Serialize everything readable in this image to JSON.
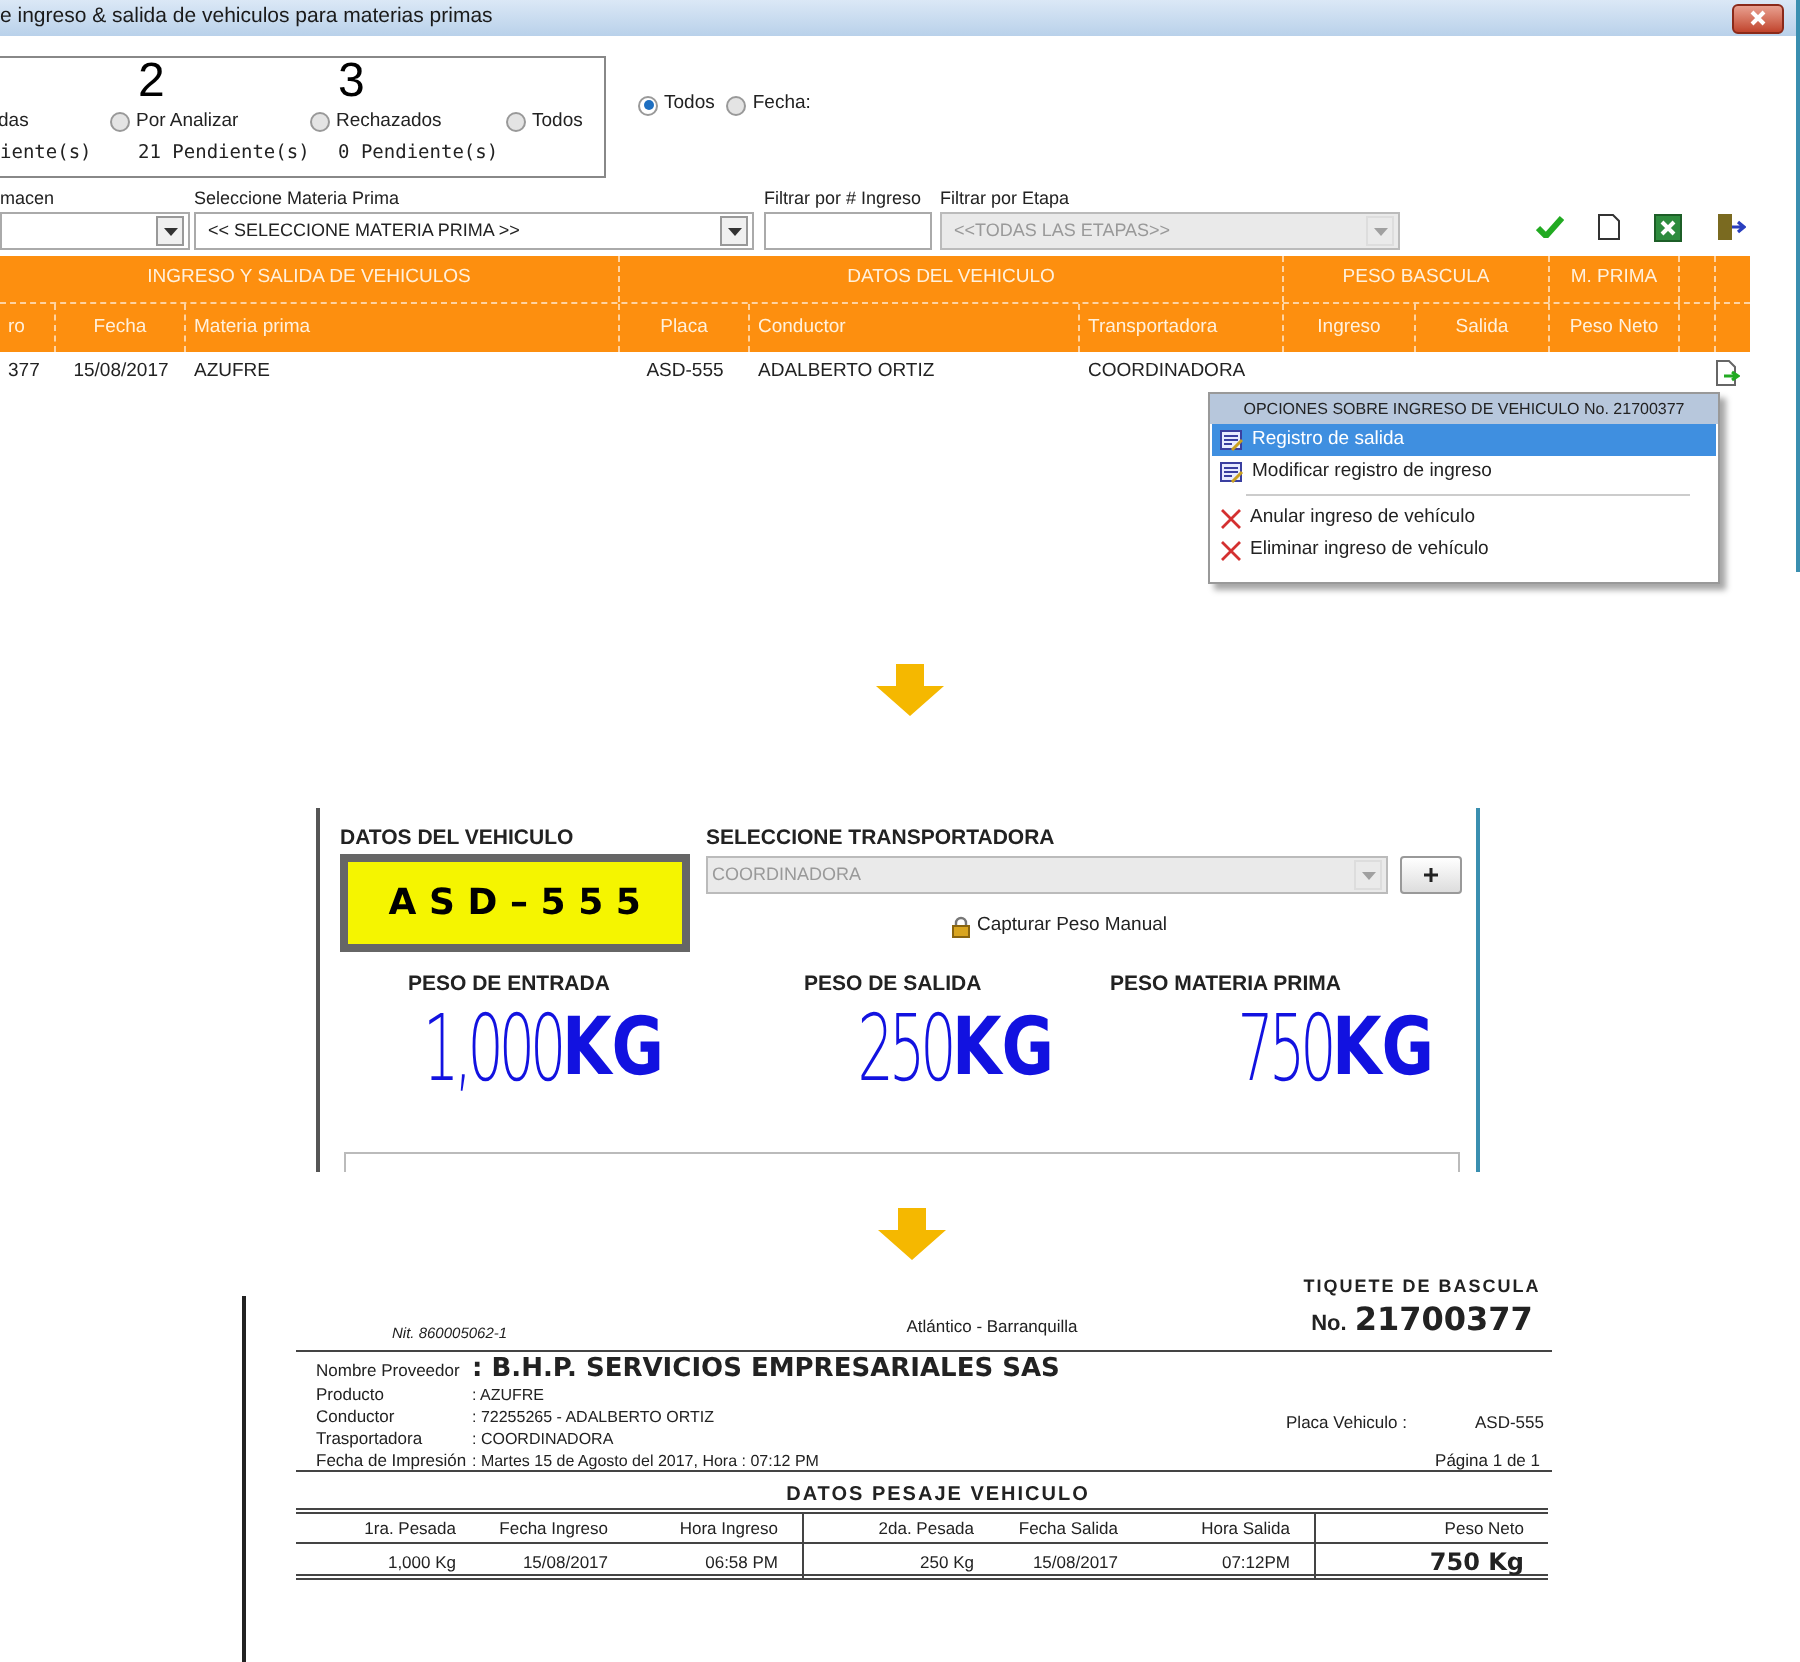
{
  "window": {
    "title": "e ingreso & salida de vehiculos para materias primas"
  },
  "status_filters": [
    {
      "kind": "cut",
      "label": "das",
      "pending": "iente(s)"
    },
    {
      "kind": "radio",
      "count": "2",
      "label": "Por Analizar",
      "pending": "21 Pendiente(s)",
      "selected": false
    },
    {
      "kind": "radio",
      "count": "3",
      "label": "Rechazados",
      "pending": "0 Pendiente(s)",
      "selected": false
    },
    {
      "kind": "radio",
      "label": "Todos",
      "selected": false
    }
  ],
  "date_filter": [
    {
      "label": "Todos",
      "selected": true
    },
    {
      "label": "Fecha:",
      "selected": false
    }
  ],
  "filters": [
    {
      "kind": "combo",
      "label": "macen"
    },
    {
      "kind": "combo",
      "label": "Seleccione Materia Prima",
      "value": "<< SELECCIONE MATERIA PRIMA >>"
    },
    {
      "kind": "text",
      "label": "Filtrar por # Ingreso"
    },
    {
      "kind": "combo",
      "label": "Filtrar por Etapa",
      "value": "<<TODAS LAS ETAPAS>>",
      "disabled": true
    }
  ],
  "table": {
    "groups": [
      "INGRESO Y SALIDA DE VEHICULOS",
      "DATOS DEL VEHICULO",
      "PESO BASCULA",
      "M. PRIMA"
    ],
    "columns": [
      "ro",
      "Fecha",
      "Materia prima",
      "Placa",
      "Conductor",
      "Transportadora",
      "Ingreso",
      "Salida",
      "Peso Neto"
    ],
    "rows": [
      [
        "377",
        "15/08/2017",
        "AZUFRE",
        "ASD-555",
        "ADALBERTO ORTIZ",
        "COORDINADORA"
      ]
    ]
  },
  "context_menu": {
    "title": "OPCIONES SOBRE INGRESO DE VEHICULO No. 21700377",
    "items": [
      {
        "kind": "edit",
        "label": "Registro de salida",
        "selected": true
      },
      {
        "kind": "edit",
        "label": "Modificar registro de ingreso",
        "selected": false
      },
      {
        "kind": "delete",
        "label": "Anular ingreso de vehículo",
        "selected": false
      },
      {
        "kind": "delete",
        "label": "Eliminar ingreso de vehículo",
        "selected": false
      }
    ]
  },
  "vehicle_panel": {
    "heading": "DATOS DEL VEHICULO",
    "plate": "ASD–555",
    "transport_heading": "SELECCIONE TRANSPORTADORA",
    "transport_value": "COORDINADORA",
    "manual_capture": "Capturar Peso Manual",
    "weights": [
      {
        "label": "PESO DE ENTRADA",
        "value": "1,000",
        "unit": "KG"
      },
      {
        "label": "PESO DE SALIDA",
        "value": "250",
        "unit": "KG"
      },
      {
        "label": "PESO MATERIA PRIMA",
        "value": "750",
        "unit": "KG"
      }
    ]
  },
  "ticket": {
    "nit": "Nit. 860005062-1",
    "city": "Atlántico - Barranquilla",
    "title": "TIQUETE DE BASCULA",
    "number_prefix": "No.",
    "number": "21700377",
    "fields": [
      {
        "label": "Nombre Proveedor",
        "value": ": B.H.P. SERVICIOS EMPRESARIALES SAS",
        "kind": "strong"
      },
      {
        "label": "Producto",
        "value": ": AZUFRE",
        "kind": "plain"
      },
      {
        "label": "Conductor",
        "value": ": 72255265 - ADALBERTO ORTIZ",
        "kind": "plain"
      },
      {
        "label": "Trasportadora",
        "value": ": COORDINADORA",
        "kind": "plain"
      },
      {
        "label": "Fecha de Impresión",
        "value": ": Martes 15 de Agosto del 2017, Hora : 07:12 PM",
        "kind": "plain"
      }
    ],
    "plate_label": "Placa Vehiculo :",
    "plate_value": "ASD-555",
    "page": "Página 1 de 1",
    "section_title": "DATOS PESAJE VEHICULO",
    "columns": [
      "1ra. Pesada",
      "Fecha Ingreso",
      "Hora Ingreso",
      "2da. Pesada",
      "Fecha Salida",
      "Hora Salida",
      "Peso Neto"
    ],
    "row": [
      "1,000 Kg",
      "15/08/2017",
      "06:58 PM",
      "250 Kg",
      "15/08/2017",
      "07:12PM",
      "750 Kg"
    ]
  }
}
